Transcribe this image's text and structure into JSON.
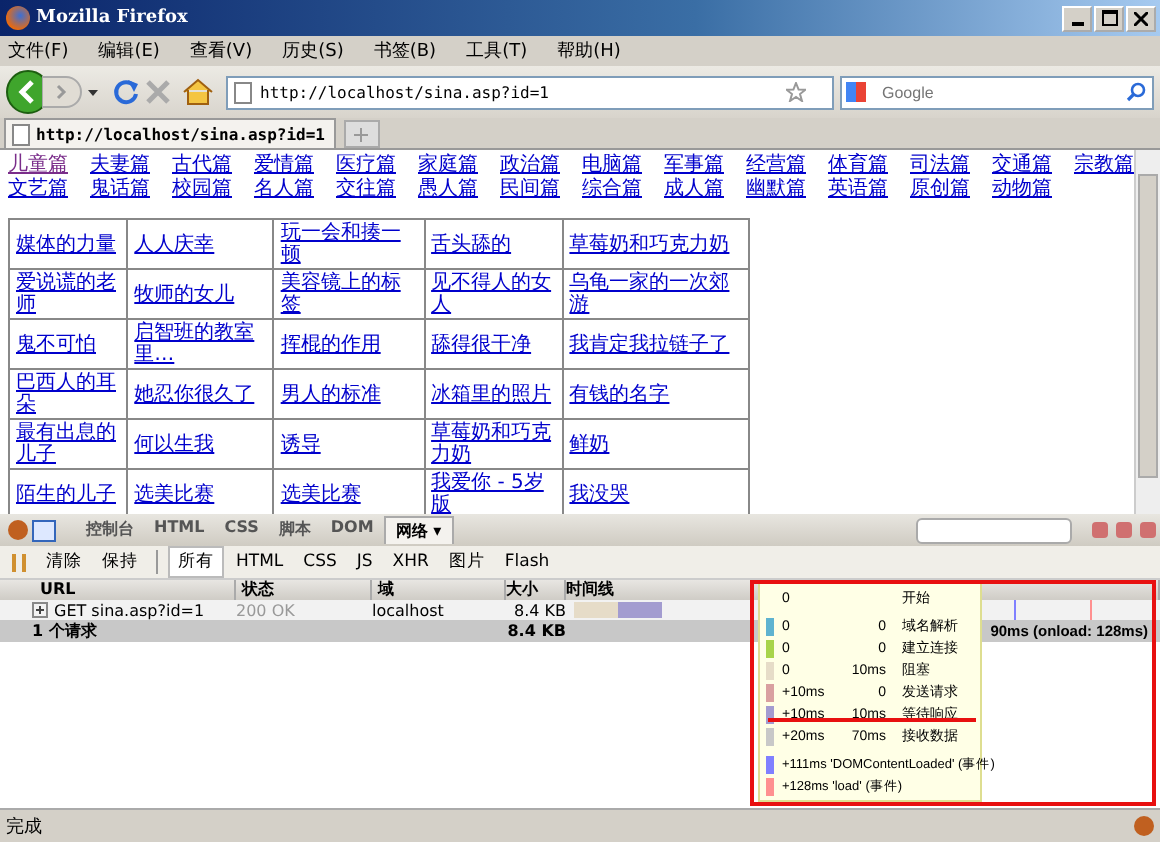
{
  "window": {
    "title": "Mozilla Firefox"
  },
  "menu": [
    "文件(F)",
    "编辑(E)",
    "查看(V)",
    "历史(S)",
    "书签(B)",
    "工具(T)",
    "帮助(H)"
  ],
  "address": {
    "value": "http://localhost/sina.asp?id=1"
  },
  "search": {
    "placeholder": "Google"
  },
  "tabs": [
    {
      "label": "http://localhost/sina.asp?id=1",
      "selected": true
    }
  ],
  "categories": [
    {
      "label": "儿童篇",
      "visited": true
    },
    {
      "label": "夫妻篇",
      "visited": false
    },
    {
      "label": "古代篇",
      "visited": false
    },
    {
      "label": "爱情篇",
      "visited": false
    },
    {
      "label": "医疗篇",
      "visited": false
    },
    {
      "label": "家庭篇",
      "visited": false
    },
    {
      "label": "政治篇",
      "visited": false
    },
    {
      "label": "电脑篇",
      "visited": false
    },
    {
      "label": "军事篇",
      "visited": false
    },
    {
      "label": "经营篇",
      "visited": false
    },
    {
      "label": "体育篇",
      "visited": false
    },
    {
      "label": "司法篇",
      "visited": false
    },
    {
      "label": "交通篇",
      "visited": false
    },
    {
      "label": "宗教篇",
      "visited": false
    },
    {
      "label": "文艺篇",
      "visited": false
    },
    {
      "label": "鬼话篇",
      "visited": false
    },
    {
      "label": "校园篇",
      "visited": false
    },
    {
      "label": "名人篇",
      "visited": false
    },
    {
      "label": "交往篇",
      "visited": false
    },
    {
      "label": "愚人篇",
      "visited": false
    },
    {
      "label": "民间篇",
      "visited": false
    },
    {
      "label": "综合篇",
      "visited": false
    },
    {
      "label": "成人篇",
      "visited": false
    },
    {
      "label": "幽默篇",
      "visited": false
    },
    {
      "label": "英语篇",
      "visited": false
    },
    {
      "label": "原创篇",
      "visited": false
    },
    {
      "label": "动物篇",
      "visited": false
    }
  ],
  "stories": [
    [
      "媒体的力量",
      "人人庆幸",
      "玩一会和揍一顿",
      "舌头舔的",
      "草莓奶和巧克力奶"
    ],
    [
      "爱说谎的老师",
      "牧师的女儿",
      "美容镜上的标签",
      "见不得人的女人",
      "乌龟一家的一次郊游"
    ],
    [
      "鬼不可怕",
      "启智班的教室里…",
      "挥棍的作用",
      "舔得很干净",
      "我肯定我拉链子了"
    ],
    [
      "巴西人的耳朵",
      "她忍你很久了",
      "男人的标准",
      "冰箱里的照片",
      "有钱的名字"
    ],
    [
      "最有出息的儿子",
      "何以生我",
      "诱导",
      "草莓奶和巧克力奶",
      "鲜奶"
    ],
    [
      "陌生的儿子",
      "选美比赛",
      "选美比赛",
      "我爱你 - 5岁版",
      "我没哭"
    ]
  ],
  "firebug": {
    "tabs": [
      {
        "label": "控制台",
        "selected": false
      },
      {
        "label": "HTML",
        "selected": false
      },
      {
        "label": "CSS",
        "selected": false
      },
      {
        "label": "脚本",
        "selected": false
      },
      {
        "label": "DOM",
        "selected": false
      },
      {
        "label": "网络 ▾",
        "selected": true
      }
    ],
    "actions": [
      "清除",
      "保持"
    ],
    "filters": [
      {
        "label": "所有",
        "selected": true
      },
      {
        "label": "HTML",
        "selected": false
      },
      {
        "label": "CSS",
        "selected": false
      },
      {
        "label": "JS",
        "selected": false
      },
      {
        "label": "XHR",
        "selected": false
      },
      {
        "label": "图片",
        "selected": false
      },
      {
        "label": "Flash",
        "selected": false
      }
    ],
    "columns": [
      "URL",
      "状态",
      "域",
      "大小",
      "时间线"
    ],
    "requests": [
      {
        "url": "GET sina.asp?id=1",
        "status": "200 OK",
        "domain": "localhost",
        "size": "8.4 KB"
      }
    ],
    "summary": {
      "count": "1 个请求",
      "size": "8.4 KB",
      "time": "90ms (onload: 128ms)"
    },
    "timings": [
      {
        "start": "0",
        "label": "开始"
      },
      {
        "start": "0",
        "duration": "0",
        "label": "域名解析",
        "color": "#5fb3d0"
      },
      {
        "start": "0",
        "duration": "0",
        "label": "建立连接",
        "color": "#a8d44a"
      },
      {
        "start": "0",
        "duration": "10ms",
        "label": "阻塞",
        "color": "#e6dcc8"
      },
      {
        "start": "+10ms",
        "duration": "0",
        "label": "发送请求",
        "color": "#d9a0a0"
      },
      {
        "start": "+10ms",
        "duration": "10ms",
        "label": "等待响应",
        "color": "#a39cd0"
      },
      {
        "start": "+20ms",
        "duration": "70ms",
        "label": "接收数据",
        "color": "#c8c8c8"
      }
    ],
    "events": [
      {
        "text": "+111ms 'DOMContentLoaded' (事件)",
        "color": "#8080ff"
      },
      {
        "text": "+128ms 'load' (事件)",
        "color": "#ff9090"
      }
    ]
  },
  "status_bar": {
    "text": "完成"
  }
}
